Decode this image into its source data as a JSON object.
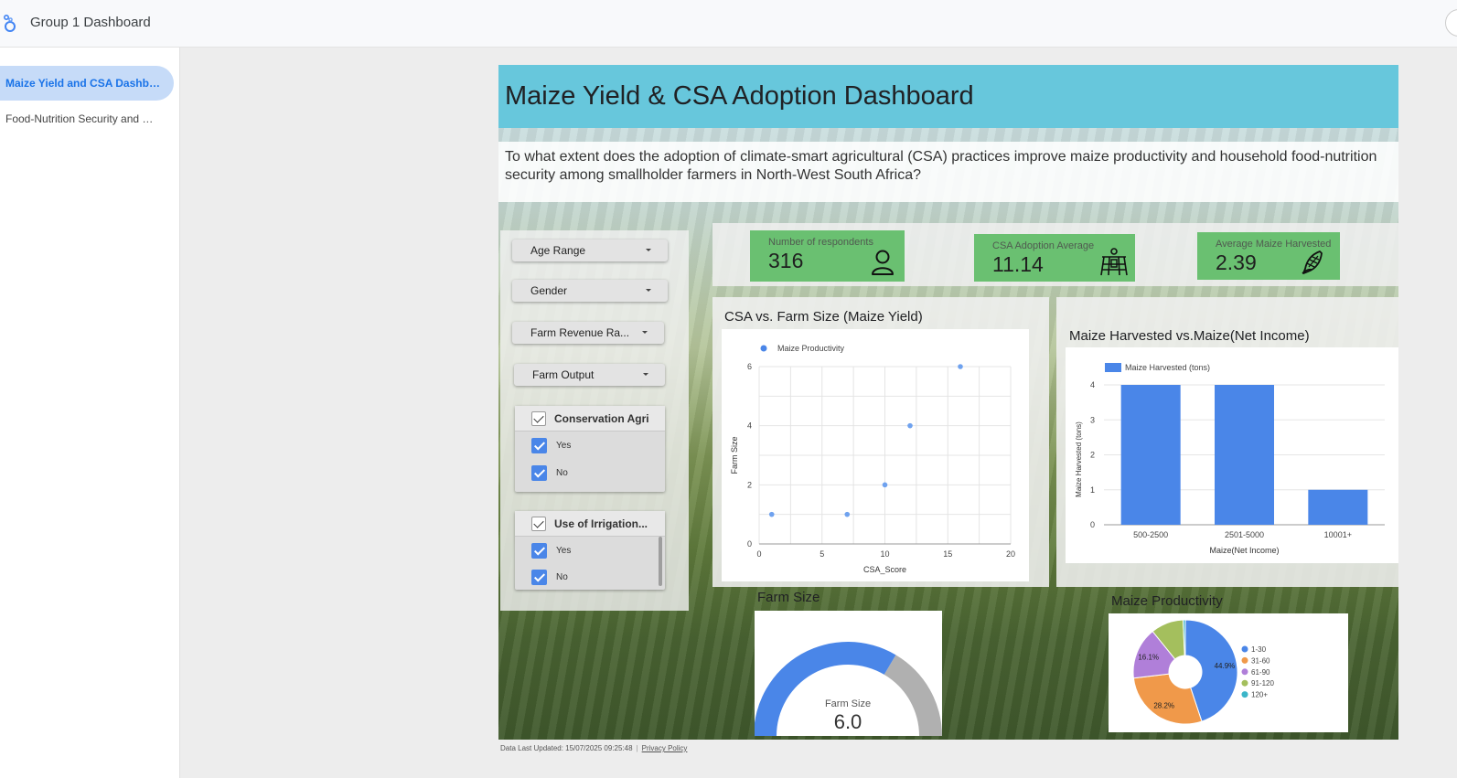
{
  "app": {
    "title": "Group 1 Dashboard"
  },
  "sidebar": {
    "items": [
      {
        "label": "Maize Yield and CSA Dashboard",
        "active": true
      },
      {
        "label": "Food-Nutrition Security and CSA",
        "active": false
      }
    ]
  },
  "report": {
    "title": "Maize Yield & CSA Adoption Dashboard",
    "question": "To what extent does the adoption of climate-smart agricultural (CSA) practices improve maize productivity and household food-nutrition security among smallholder farmers in North-West South Africa?"
  },
  "filters": {
    "dropdowns": [
      {
        "label": "Age Range"
      },
      {
        "label": "Gender"
      },
      {
        "label": "Farm Revenue Ra..."
      },
      {
        "label": "Farm Output"
      }
    ],
    "checklists": [
      {
        "title": "Conservation Agri",
        "options": [
          "Yes",
          "No"
        ]
      },
      {
        "title": "Use of Irrigation...",
        "options": [
          "Yes",
          "No"
        ]
      }
    ]
  },
  "kpis": [
    {
      "label": "Number of respondents",
      "value": "316",
      "icon": "person-icon"
    },
    {
      "label": "CSA Adoption Average",
      "value": "11.14",
      "icon": "farmer-tools-icon"
    },
    {
      "label": "Average Maize Harvested",
      "value": "2.39",
      "icon": "corn-icon"
    }
  ],
  "colors": {
    "accent_blue": "#4a86e8",
    "kpi_green": "#6ac071",
    "header_cyan": "#67c7dc",
    "gauge_grey": "#b0b0b0"
  },
  "chart_data": [
    {
      "type": "scatter",
      "title": "CSA vs. Farm Size (Maize Yield)",
      "series": [
        {
          "name": "Maize Productivity",
          "x": [
            1,
            7,
            10,
            12,
            16
          ],
          "y": [
            1,
            1,
            2,
            4,
            6
          ]
        }
      ],
      "xlabel": "CSA_Score",
      "ylabel": "Farm Size",
      "xlim": [
        0,
        20
      ],
      "ylim": [
        0,
        6
      ],
      "xticks": [
        0,
        5,
        10,
        15,
        20
      ],
      "yticks": [
        0,
        2,
        4,
        6
      ],
      "grid": true,
      "legend": "top-left"
    },
    {
      "type": "bar",
      "title": "Maize Harvested vs.Maize(Net Income)",
      "categories": [
        "500-2500",
        "2501-5000",
        "10001+"
      ],
      "series": [
        {
          "name": "Maize Harvested (tons)",
          "values": [
            4,
            4,
            1
          ]
        }
      ],
      "xlabel": "Maize(Net Income)",
      "ylabel": "Maize Harvested (tons)",
      "ylim": [
        0,
        4
      ],
      "yticks": [
        0,
        1,
        2,
        3,
        4
      ],
      "grid": true,
      "legend": "top-left"
    },
    {
      "type": "gauge",
      "title": "Farm Size",
      "label": "Farm Size",
      "value": 6.0,
      "display_value": "6.0",
      "fill_fraction": 0.67
    },
    {
      "type": "pie",
      "title": "Maize Productivity",
      "categories": [
        "1-30",
        "31-60",
        "61-90",
        "91-120",
        "120+"
      ],
      "values": [
        44.9,
        28.2,
        16.1,
        10.1,
        0.7
      ],
      "labels": [
        "44.9%",
        "28.2%",
        "16.1%",
        "",
        ""
      ],
      "colors": [
        "#4a86e8",
        "#f0994a",
        "#b07fd9",
        "#a4bf5d",
        "#3cb6c9"
      ],
      "legend": "right"
    }
  ],
  "footer": {
    "updated": "Data Last Updated: 15/07/2025 09:25:48",
    "privacy": "Privacy Policy"
  }
}
